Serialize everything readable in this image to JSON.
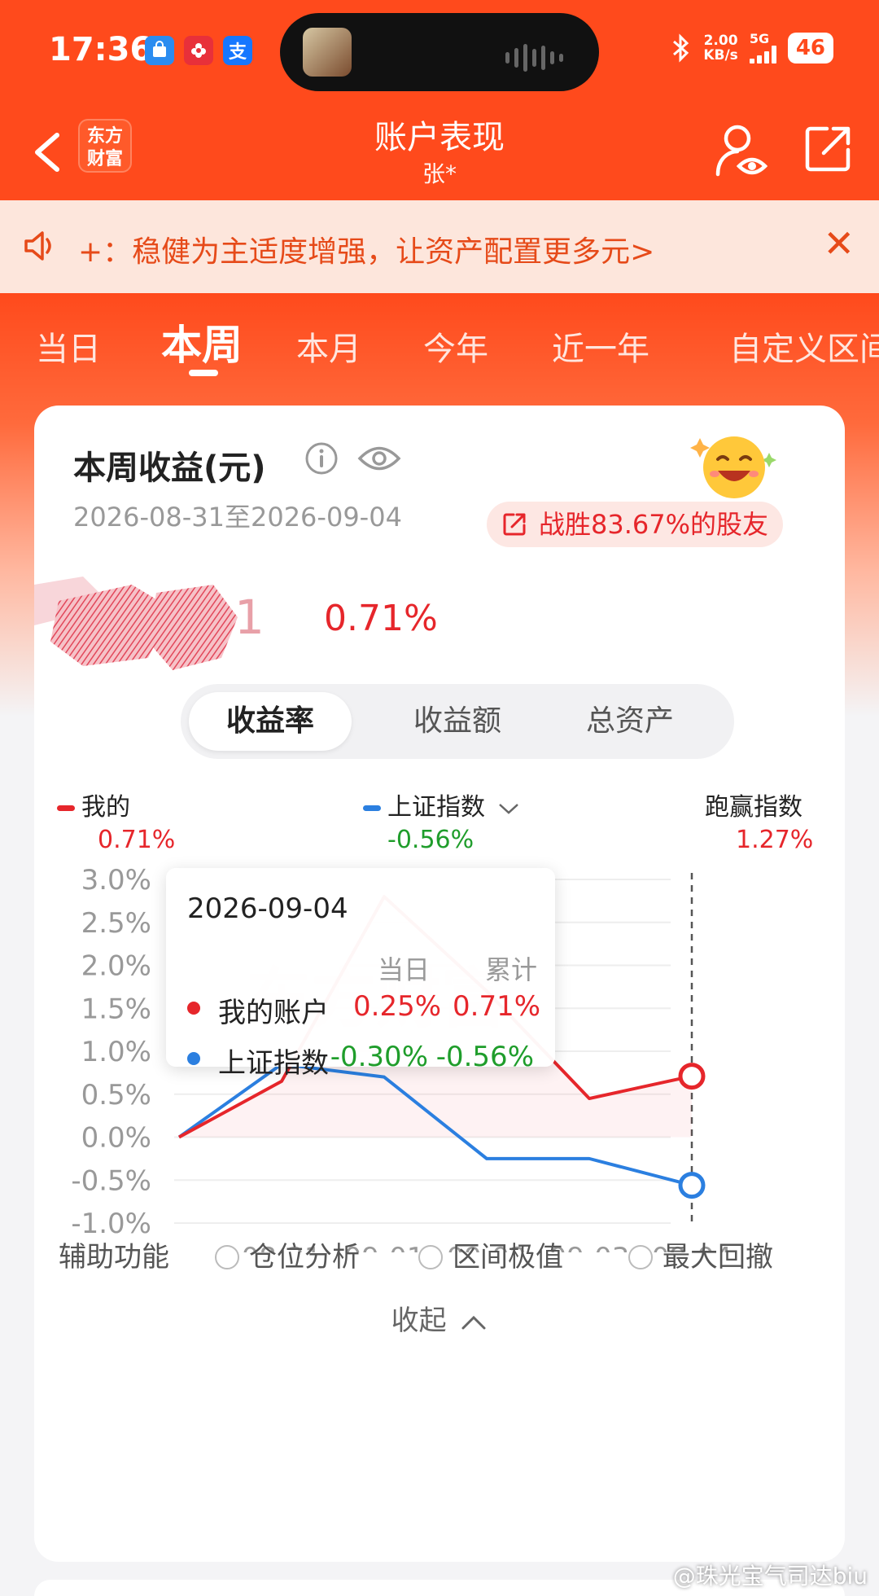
{
  "status_bar": {
    "time": "17:36",
    "speed": "2.00",
    "speed_unit": "KB/s",
    "network": "5G",
    "battery": "46",
    "apps": [
      "bag-app-icon",
      "flower-app-icon",
      "alipay-app-icon"
    ],
    "alipay_char": "支"
  },
  "header": {
    "title": "账户表现",
    "subtitle": "张*",
    "logo_line1": "东方",
    "logo_line2": "财富"
  },
  "notice": {
    "text": "+：稳健为主适度增强，让资产配置更多元>",
    "close": "✕"
  },
  "period_tabs": {
    "items": [
      "当日",
      "本周",
      "本月",
      "今年",
      "近一年",
      "自定义区间"
    ],
    "active": "本周"
  },
  "card": {
    "title": "本周收益(元)",
    "date_range": "2026-08-31至2026-09-04",
    "beat_badge": "战胜83.67%的股友",
    "return_pct": "0.71%",
    "redacted_prefix": "1",
    "metric_tabs": [
      "收益率",
      "收益额",
      "总资产"
    ],
    "active_metric": "收益率",
    "legend": {
      "mine_label": "我的",
      "mine_value": "0.71%",
      "index_label": "上证指数",
      "index_value": "-0.56%",
      "excess_label": "跑赢指数",
      "excess_value": "1.27%"
    },
    "tooltip": {
      "date": "2026-09-04",
      "col_day": "当日",
      "col_total": "累计",
      "rows": [
        {
          "name": "我的账户",
          "day": "0.25%",
          "total": "0.71%"
        },
        {
          "name": "上证指数",
          "day": "-0.30%",
          "total": "-0.56%"
        }
      ]
    },
    "aux_label": "辅助功能",
    "aux_options": [
      "仓位分析",
      "区间极值",
      "最大回撤"
    ],
    "collapse": "收起"
  },
  "chart_data": {
    "type": "line",
    "x": [
      "08-27",
      "08-31",
      "09-01",
      "09-02",
      "09-03",
      "09-04"
    ],
    "series": [
      {
        "name": "我的",
        "values": [
          0.0,
          0.65,
          2.8,
          1.7,
          0.45,
          0.71
        ]
      },
      {
        "name": "上证指数",
        "values": [
          0.0,
          0.85,
          0.7,
          -0.25,
          -0.25,
          -0.56
        ]
      }
    ],
    "y_ticks": [
      "3.0%",
      "2.5%",
      "2.0%",
      "1.5%",
      "1.0%",
      "0.5%",
      "0.0%",
      "-0.5%",
      "-1.0%"
    ],
    "x_tick_labels": [
      "08-31",
      "09-01",
      "09-02",
      "09-03",
      "09-04"
    ],
    "ylim": [
      -1.0,
      3.0
    ],
    "grid": true,
    "colors": {
      "mine": "#e6262b",
      "index": "#2b7fe0"
    },
    "highlight_x": "09-04",
    "watermark_text": "东方财富"
  },
  "watermark": "@珠光宝气司达biu",
  "colors": {
    "brand": "#ff4a1c",
    "red": "#e6262b",
    "green": "#1f9d2b",
    "blue": "#2b7fe0"
  }
}
